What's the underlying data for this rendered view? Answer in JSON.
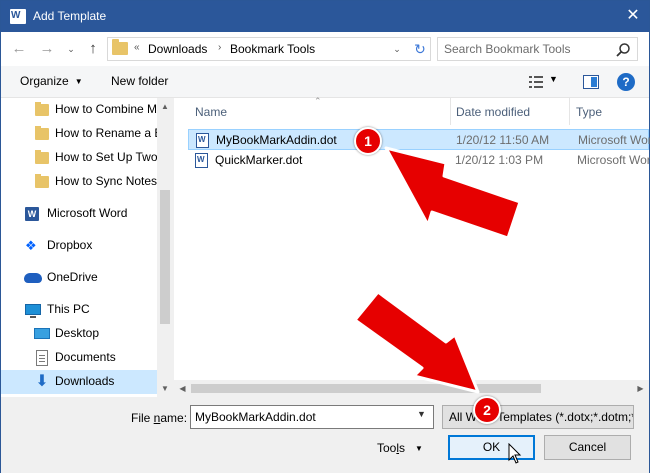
{
  "window": {
    "title": "Add Template",
    "close_glyph": "✕",
    "colors": {
      "titlebar": "#2b579a",
      "selection": "#cce8ff",
      "accent_button": "#0078d7",
      "annotation_red": "#e60000"
    }
  },
  "navbar": {
    "back_glyph": "←",
    "forward_glyph": "→",
    "recent_glyph": "⌄",
    "up_glyph": "↑",
    "overflow": "«",
    "breadcrumb": [
      "Downloads",
      "Bookmark Tools"
    ],
    "separator": "›",
    "refresh_glyph": "↻",
    "search_placeholder": "Search Bookmark Tools"
  },
  "toolbar": {
    "organize_label": "Organize",
    "new_folder_label": "New folder",
    "caret": "▼",
    "help_glyph": "?"
  },
  "sidebar": {
    "items": [
      {
        "label": "How to Combine M",
        "icon": "folder-icon"
      },
      {
        "label": "How to Rename a E",
        "icon": "folder-icon"
      },
      {
        "label": "How to Set Up Two",
        "icon": "folder-icon"
      },
      {
        "label": "How to Sync Notes",
        "icon": "folder-icon"
      },
      {
        "label": "Microsoft Word",
        "icon": "word-icon"
      },
      {
        "label": "Dropbox",
        "icon": "dropbox-icon"
      },
      {
        "label": "OneDrive",
        "icon": "onedrive-icon"
      },
      {
        "label": "This PC",
        "icon": "computer-icon"
      },
      {
        "label": "Desktop",
        "icon": "desktop-icon"
      },
      {
        "label": "Documents",
        "icon": "documents-icon"
      },
      {
        "label": "Downloads",
        "icon": "downloads-icon",
        "selected": true
      }
    ],
    "scroll_up": "▲",
    "scroll_down": "▼"
  },
  "filelist": {
    "columns": [
      "Name",
      "Date modified",
      "Type"
    ],
    "sort_glyph": "⌃",
    "rows": [
      {
        "name": "MyBookMarkAddin.dot",
        "date": "1/20/12 11:50 AM",
        "type": "Microsoft Word",
        "selected": true
      },
      {
        "name": "QuickMarker.dot",
        "date": "1/20/12 1:03 PM",
        "type": "Microsoft Word",
        "selected": false
      }
    ],
    "scroll_left": "◀",
    "scroll_right": "▶"
  },
  "footer": {
    "filename_label_pre": "File ",
    "filename_label_accel": "n",
    "filename_label_post": "ame:",
    "filename_value": "MyBookMarkAddin.dot",
    "filetype_value": "All Word Templates (*.dotx;*.dotm;*.dot)",
    "tools_pre": "Too",
    "tools_accel": "l",
    "tools_post": "s",
    "ok_label": "OK",
    "cancel_label": "Cancel",
    "dropdown_glyph": "▼"
  },
  "annotations": {
    "badge_1": "1",
    "badge_2": "2"
  }
}
